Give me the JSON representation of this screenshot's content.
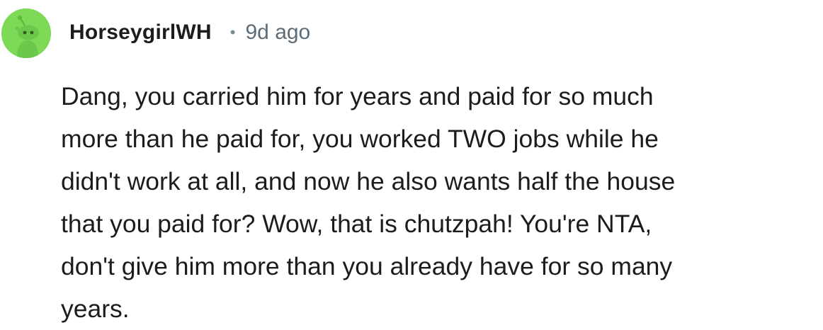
{
  "comment": {
    "avatar_icon": "reddit-snoo-avatar-icon",
    "avatar_color": "#7ed957",
    "username": "HorseygirlWH",
    "separator": "•",
    "time": "9d ago",
    "body": "Dang, you carried him for years and paid for so much\nmore than he paid for, you worked TWO jobs while he\ndidn't work at all, and now he also wants half the house\nthat you paid for? Wow, that is chutzpah! You're NTA,\ndon't give him more than you already have for so many\nyears."
  }
}
